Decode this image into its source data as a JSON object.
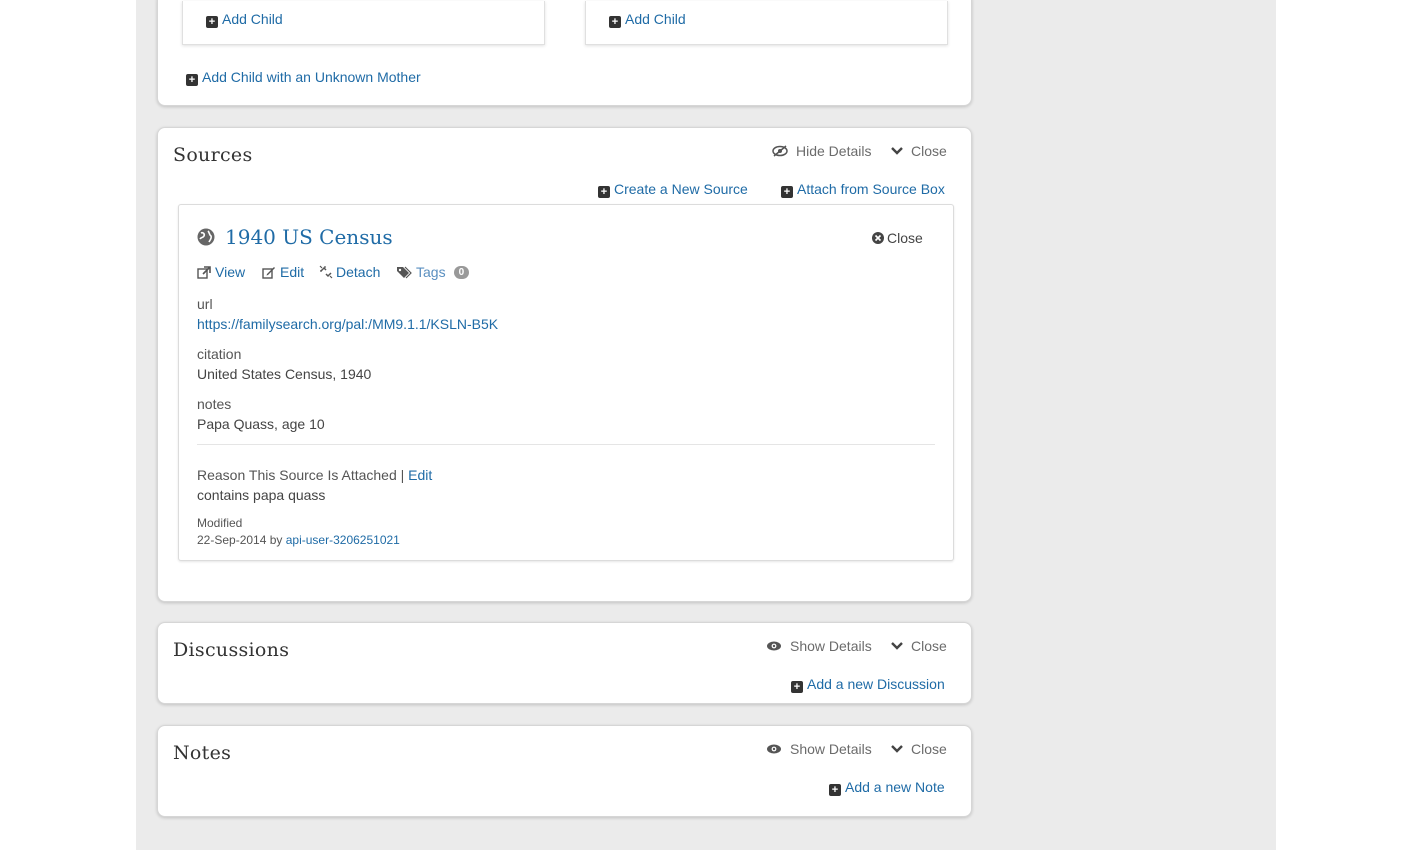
{
  "family": {
    "add_child_left": "Add Child",
    "add_child_right": "Add Child",
    "add_child_unknown_mother": "Add Child with an Unknown Mother"
  },
  "sources": {
    "title": "Sources",
    "hide_details": "Hide Details",
    "close": "Close",
    "create_new": "Create a New Source",
    "attach_box": "Attach from Source Box",
    "source": {
      "title": "1940 US Census",
      "close": "Close",
      "actions": {
        "view": "View",
        "edit": "Edit",
        "detach": "Detach",
        "tags": "Tags",
        "tag_count": "0"
      },
      "url_label": "url",
      "url_value": "https://familysearch.org/pal:/MM9.1.1/KSLN-B5K",
      "citation_label": "citation",
      "citation_value": "United States Census, 1940",
      "notes_label": "notes",
      "notes_value": "Papa Quass, age 10",
      "reason_label": "Reason This Source Is Attached |",
      "reason_edit": "Edit",
      "reason_value": "contains papa quass",
      "modified_label": "Modified",
      "modified_date": "22-Sep-2014 by",
      "modified_user": "api-user-3206251021"
    }
  },
  "discussions": {
    "title": "Discussions",
    "show_details": "Show Details",
    "close": "Close",
    "add": "Add a new Discussion"
  },
  "notes": {
    "title": "Notes",
    "show_details": "Show Details",
    "close": "Close",
    "add": "Add a new Note"
  },
  "colors": {
    "link": "#1f6ba6",
    "background": "#ebebeb",
    "text": "#333333"
  }
}
